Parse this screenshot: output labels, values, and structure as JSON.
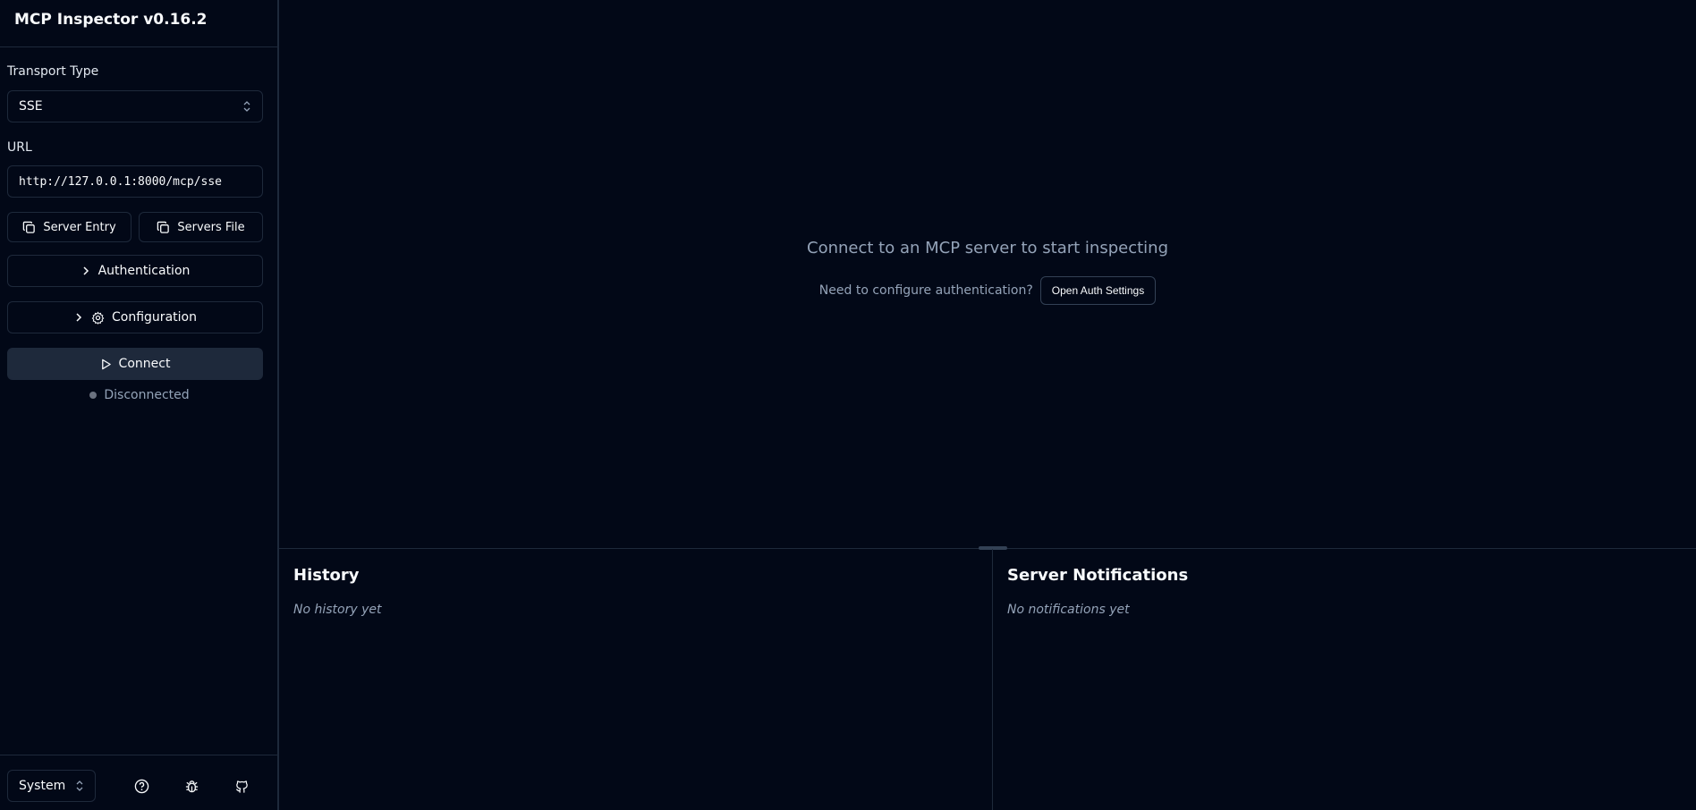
{
  "app": {
    "title": "MCP Inspector v0.16.2"
  },
  "sidebar": {
    "transport_label": "Transport Type",
    "transport_value": "SSE",
    "url_label": "URL",
    "url_value": "http://127.0.0.1:8000/mcp/sse",
    "server_entry_label": "Server Entry",
    "servers_file_label": "Servers File",
    "authentication_label": "Authentication",
    "configuration_label": "Configuration",
    "connect_label": "Connect",
    "status_text": "Disconnected",
    "status_color": "#6b7280"
  },
  "footer": {
    "theme_value": "System",
    "icons": [
      "help-icon",
      "bug-icon",
      "github-icon"
    ]
  },
  "main": {
    "empty_title": "Connect to an MCP server to start inspecting",
    "auth_prompt": "Need to configure authentication?",
    "auth_button": "Open Auth Settings"
  },
  "history": {
    "title": "History",
    "empty": "No history yet"
  },
  "notifications": {
    "title": "Server Notifications",
    "empty": "No notifications yet"
  },
  "colors": {
    "background": "#020817",
    "border": "#1e293b",
    "muted": "#94a3b8",
    "accent_button": "#1e293b"
  }
}
